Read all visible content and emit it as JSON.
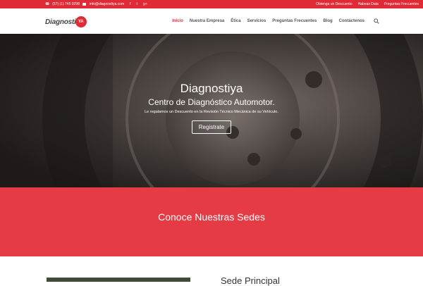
{
  "topbar": {
    "phone": "(57) (1) 745 0298",
    "email": "info@diagnostiya.com",
    "social": [
      "f",
      "t",
      "g+"
    ],
    "links": [
      "Obtenga un Descuento",
      "Habeas Data",
      "Preguntas Frecuentes"
    ]
  },
  "header": {
    "logo_text": "Diagnosti",
    "logo_badge": "YA",
    "nav": [
      "Inicio",
      "Nuestra Empresa",
      "Ética",
      "Servicios",
      "Preguntas Frecuentes",
      "Blog",
      "Contáctenos"
    ],
    "active_nav": "Inicio",
    "icons": [
      "search-icon",
      "phone-icon",
      "mail-icon",
      "facebook-icon",
      "twitter-icon",
      "google-plus-icon"
    ]
  },
  "hero": {
    "title": "Diagnostiya",
    "subtitle": "Centro de Diagnóstico Automotor.",
    "description": "Le regalamos un Descuento en la Revisión Técnico Mecánica de su Vehículo.",
    "button": "Registrate"
  },
  "sedes": {
    "heading": "Conoce Nuestras Sedes"
  },
  "bottom": {
    "sede_title": "Sede Principal"
  },
  "colors": {
    "accent": "#e02b36",
    "section_red": "#e53b44",
    "hero_dark": "#2a2624"
  }
}
